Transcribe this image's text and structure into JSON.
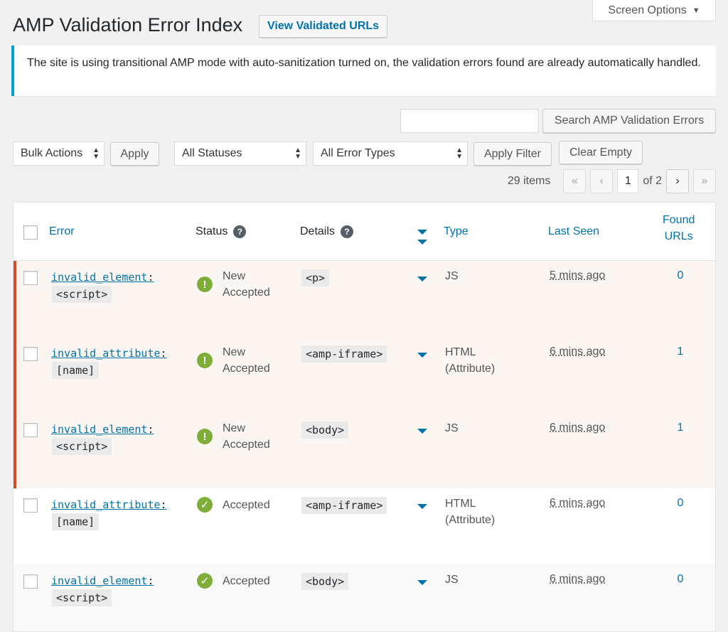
{
  "screen_options": {
    "label": "Screen Options"
  },
  "page": {
    "title": "AMP Validation Error Index",
    "view_urls": "View Validated URLs"
  },
  "notice": {
    "text": "The site is using transitional AMP mode with auto-sanitization turned on, the validation errors found are already automatically handled."
  },
  "search": {
    "value": "",
    "button": "Search AMP Validation Errors"
  },
  "filters": {
    "bulk_actions": "Bulk Actions",
    "apply": "Apply",
    "statuses": "All Statuses",
    "error_types": "All Error Types",
    "apply_filter": "Apply Filter",
    "clear_empty": "Clear Empty"
  },
  "pagination": {
    "items": "29 items",
    "first": "«",
    "prev": "‹",
    "current": "1",
    "of": "of 2",
    "next": "›",
    "last": "»"
  },
  "columns": {
    "error": "Error",
    "status": "Status",
    "details": "Details",
    "type": "Type",
    "last_seen": "Last Seen",
    "found_urls_1": "Found",
    "found_urls_2": "URLs"
  },
  "rows": [
    {
      "code": "invalid_element",
      "node": "<script>",
      "status_1": "New",
      "status_2": "Accepted",
      "details": "<p>",
      "type_1": "JS",
      "type_2": "",
      "last_seen": "5 mins ago",
      "found": "0",
      "icon": "!"
    },
    {
      "code": "invalid_attribute",
      "node": "[name]",
      "status_1": "New",
      "status_2": "Accepted",
      "details": "<amp-iframe>",
      "type_1": "HTML",
      "type_2": "(Attribute)",
      "last_seen": "6 mins ago",
      "found": "1",
      "icon": "!"
    },
    {
      "code": "invalid_element",
      "node": "<script>",
      "status_1": "New",
      "status_2": "Accepted",
      "details": "<body>",
      "type_1": "JS",
      "type_2": "",
      "last_seen": "6 mins ago",
      "found": "1",
      "icon": "!"
    },
    {
      "code": "invalid_attribute",
      "node": "[name]",
      "status_1": "Accepted",
      "status_2": "",
      "details": "<amp-iframe>",
      "type_1": "HTML",
      "type_2": "(Attribute)",
      "last_seen": "6 mins ago",
      "found": "0",
      "icon": "✓"
    },
    {
      "code": "invalid_element",
      "node": "<script>",
      "status_1": "Accepted",
      "status_2": "",
      "details": "<body>",
      "type_1": "JS",
      "type_2": "",
      "last_seen": "6 mins ago",
      "found": "0",
      "icon": "✓"
    }
  ],
  "colors": {
    "accent": "#0073aa",
    "new_marker": "#d54e21",
    "status_green": "#7ead3a",
    "notice_border": "#00a0d2"
  }
}
